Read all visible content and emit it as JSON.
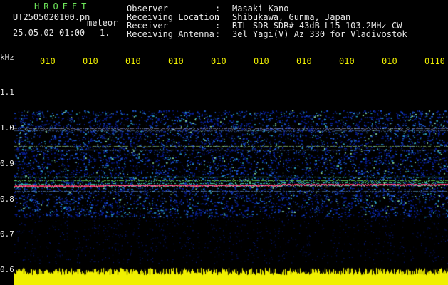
{
  "header": {
    "title": "HROFFT",
    "filename": "UT2505020100.pn",
    "mode": "meteor",
    "datetime": "25.05.02 01:00",
    "count": "1.",
    "info": [
      {
        "label": "Observer",
        "sep": ":",
        "value": "Masaki Kano"
      },
      {
        "label": "Receiving Location",
        "sep": ":",
        "value": "Shibukawa, Gunma, Japan"
      },
      {
        "label": "Receiver",
        "sep": ":",
        "value": "RTL-SDR SDR# 43dB L15 103.2MHz CW"
      },
      {
        "label": "Receiving Antenna",
        "sep": ":",
        "value": "3el Yagi(V) Az 330 for Vladivostok"
      }
    ]
  },
  "axis": {
    "unit": "kHz",
    "y_ticks": [
      "1.1",
      "1.0",
      "0.9",
      "0.8",
      "0.7",
      "0.6"
    ],
    "x_ticks": [
      "010",
      "010",
      "010",
      "010",
      "010",
      "010",
      "010",
      "010",
      "010",
      "0110"
    ]
  },
  "colors": {
    "title": "#6ee65a",
    "text": "#e8e8e8",
    "tick": "#f0f000",
    "noise": "#0a1a8a",
    "signal": "#e8305a",
    "amplitude": "#f0f000"
  }
}
